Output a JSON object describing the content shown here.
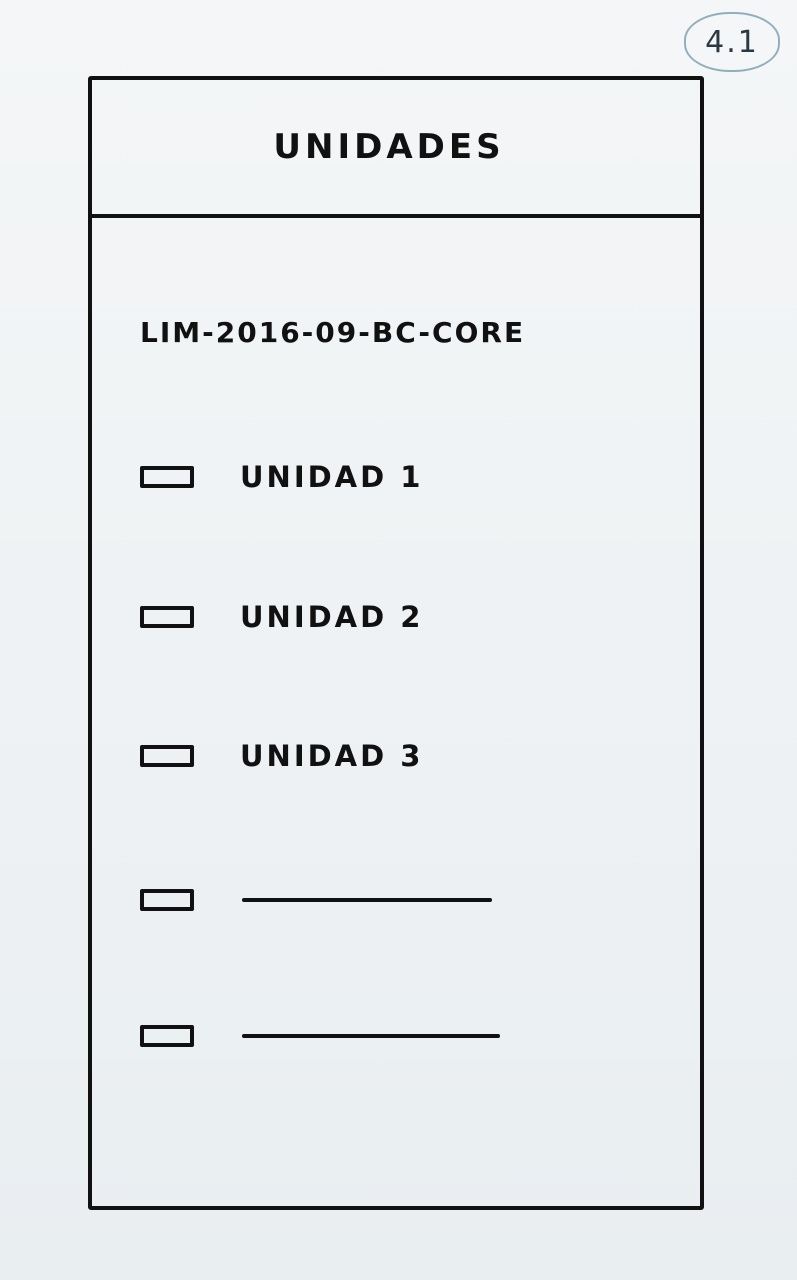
{
  "page_number": "4.1",
  "header": {
    "title": "UNIDADES"
  },
  "course": {
    "code": "LIM-2016-09-BC-CORE"
  },
  "units": [
    {
      "label": "UNIDAD 1"
    },
    {
      "label": "UNIDAD 2"
    },
    {
      "label": "UNIDAD 3"
    }
  ]
}
